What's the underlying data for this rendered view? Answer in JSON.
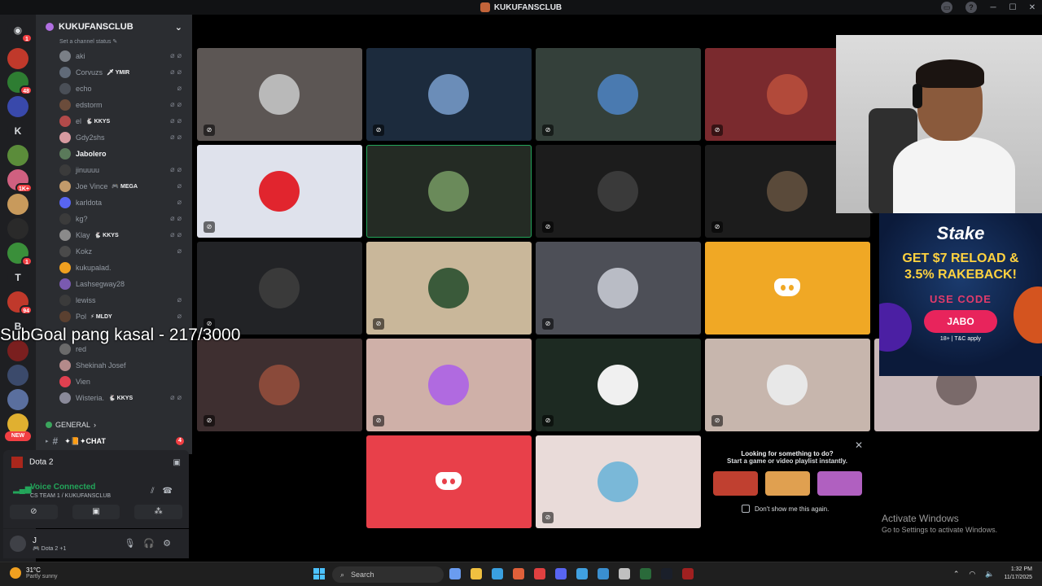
{
  "window": {
    "title": "KUKUFANSCLUB"
  },
  "rail": {
    "servers": [
      {
        "top": 0,
        "color": "#1e1f22",
        "badge": "1"
      },
      {
        "color": "#c0392b",
        "badge": ""
      },
      {
        "color": "#2e7d32",
        "badge": "48"
      },
      {
        "color": "#3949ab",
        "badge": ""
      },
      {
        "letter": "K"
      },
      {
        "color": "#5b8c3a",
        "badge": ""
      },
      {
        "color": "#d06080",
        "badge": "1K+"
      },
      {
        "color": "#c89a5c",
        "badge": ""
      },
      {
        "color": "#2a2a2a",
        "badge": ""
      },
      {
        "color": "#3a8f3a",
        "badge": "1"
      },
      {
        "letter": "T"
      },
      {
        "color": "#c0392b",
        "badge": "94"
      },
      {
        "letter": "B"
      },
      {
        "color": "#7a1f1f",
        "badge": ""
      },
      {
        "color": "#3b4a6b",
        "badge": ""
      },
      {
        "color": "#5a6f9e",
        "badge": ""
      },
      {
        "color": "#e0b030",
        "badge": ""
      }
    ],
    "new_label": "NEW"
  },
  "sidebar": {
    "server_name": "KUKUFANSCLUB",
    "status_hint": "Set a channel status",
    "members": [
      {
        "name": "aki",
        "tag": "",
        "color": "#7a7f86",
        "icons": "⌀⌀",
        "bold": false
      },
      {
        "name": "Corvuzs",
        "tag": "🗡 YMIR",
        "color": "#606a78",
        "icons": "⌀⌀",
        "bold": false
      },
      {
        "name": "echo",
        "tag": "",
        "color": "#4a4f57",
        "icons": "⌀",
        "bold": false
      },
      {
        "name": "edstorm",
        "tag": "",
        "color": "#6b4c3b",
        "icons": "⌀⌀",
        "bold": false
      },
      {
        "name": "el",
        "tag": "🐇 KKYS",
        "color": "#b24a4a",
        "icons": "⌀⌀",
        "bold": false
      },
      {
        "name": "Gdy2shs",
        "tag": "",
        "color": "#d79aa0",
        "icons": "⌀⌀",
        "bold": false
      },
      {
        "name": "Jabolero",
        "tag": "",
        "color": "#5a7a5a",
        "icons": "",
        "bold": true
      },
      {
        "name": "jinuuuu",
        "tag": "",
        "color": "#3b3b3b",
        "icons": "⌀⌀",
        "bold": false
      },
      {
        "name": "Joe Vince",
        "tag": "🎮 MEGA",
        "color": "#c29a6b",
        "icons": "⌀",
        "bold": false
      },
      {
        "name": "karldota",
        "tag": "",
        "color": "#5865f2",
        "icons": "⌀",
        "bold": false
      },
      {
        "name": "kg?",
        "tag": "",
        "color": "#3b3b3b",
        "icons": "⌀⌀",
        "bold": false
      },
      {
        "name": "Klay",
        "tag": "🐇 KKYS",
        "color": "#8a8a8a",
        "icons": "⌀⌀",
        "bold": false
      },
      {
        "name": "Kokz",
        "tag": "",
        "color": "#4a4a4a",
        "icons": "⌀",
        "bold": false
      },
      {
        "name": "kukupalad.",
        "tag": "",
        "color": "#f0a020",
        "icons": "",
        "bold": false
      },
      {
        "name": "Lashsegway28",
        "tag": "",
        "color": "#7a5ab0",
        "icons": "",
        "bold": false
      },
      {
        "name": "lewiss",
        "tag": "",
        "color": "#3b3b3b",
        "icons": "⌀",
        "bold": false
      },
      {
        "name": "Pol",
        "tag": "⚡ MLDY",
        "color": "#5a4030",
        "icons": "⌀",
        "bold": false
      },
      {
        "name": "",
        "tag": "",
        "color": "#2b2d31",
        "icons": "",
        "bold": false
      },
      {
        "name": "red",
        "tag": "",
        "color": "#6a6a6a",
        "icons": "",
        "bold": false
      },
      {
        "name": "Shekinah Josef",
        "tag": "",
        "color": "#b48a8a",
        "icons": "",
        "bold": false
      },
      {
        "name": "Vien",
        "tag": "",
        "color": "#e04050",
        "icons": "",
        "bold": false
      },
      {
        "name": "Wisteria.",
        "tag": "🐇 KKYS",
        "color": "#8a8a9a",
        "icons": "⌀⌀",
        "bold": false
      }
    ],
    "category": "GENERAL",
    "chat_channel": "✦📙✦CHAT",
    "chat_badge": "4"
  },
  "voice": {
    "activity": "Dota 2",
    "status": "Voice Connected",
    "channel": "CS TEAM 1 / KUKUFANSCLUB"
  },
  "user": {
    "name": "J",
    "status": "🎮 Dota 2 +1"
  },
  "overlay": {
    "subgoal": "SubGoal pang kasal - 217/3000"
  },
  "tiles": [
    {
      "bg": "#5c5654",
      "av": "#b9b9b9",
      "mute": true,
      "type": "avatar"
    },
    {
      "bg": "#1c2b3d",
      "av": "#6b8db8",
      "mute": true,
      "type": "avatar"
    },
    {
      "bg": "#34403a",
      "av": "#4a7ab0",
      "mute": true,
      "type": "avatar"
    },
    {
      "bg": "#7a2a2e",
      "av": "#b24a3a",
      "mute": true,
      "type": "avatar"
    },
    {
      "bg": "#dfe2ec",
      "av": "#e1252e",
      "mute": true,
      "type": "avatar"
    },
    {
      "bg": "#242b24",
      "av": "#6a8a5a",
      "mute": false,
      "type": "avatar",
      "speaking": true
    },
    {
      "bg": "#1c1c1c",
      "av": "#3a3a3a",
      "mute": true,
      "type": "avatar"
    },
    {
      "bg": "#1c1c1c",
      "av": "#5a4a3a",
      "mute": true,
      "type": "avatar"
    },
    {
      "bg": "#222326",
      "av": "#3a3a3a",
      "mute": true,
      "type": "avatar"
    },
    {
      "bg": "#c9b79a",
      "av": "#3a5a3a",
      "mute": true,
      "type": "avatar"
    },
    {
      "bg": "#4d4f57",
      "av": "#b9bcc5",
      "mute": true,
      "type": "avatar"
    },
    {
      "bg": "#f0a825",
      "mute": false,
      "type": "discord"
    },
    {
      "bg": "#3e2f30",
      "av": "#8a4a3a",
      "mute": true,
      "type": "avatar"
    },
    {
      "bg": "#cfb0a8",
      "av": "#b06ae0",
      "mute": true,
      "type": "avatar"
    },
    {
      "bg": "#1d2a22",
      "av": "#f0f0f0",
      "mute": true,
      "type": "avatar"
    },
    {
      "bg": "#c7b6ad",
      "av": "#e8e8e8",
      "mute": true,
      "type": "avatar"
    },
    {
      "bg": "#e8404a",
      "mute": false,
      "type": "discord"
    },
    {
      "bg": "#e9dbd9",
      "av": "#7ab8d8",
      "mute": true,
      "type": "avatar"
    },
    {
      "bg": "#c8b8b8",
      "av": "#7a6a6a",
      "mute": false,
      "type": "avatar"
    }
  ],
  "ad": {
    "brand": "Stake",
    "offer_line1": "GET $7 RELOAD &",
    "offer_line2": "3.5% RAKEBACK!",
    "use_code": "USE CODE",
    "code": "JABO",
    "tc": "18+ | T&C apply"
  },
  "suggest": {
    "line1": "Looking for something to do?",
    "line2": "Start a game or video playlist instantly.",
    "checkbox": "Don't show me this again.",
    "thumb_colors": [
      "#c04030",
      "#e0a050",
      "#b060c0"
    ]
  },
  "activate": {
    "title": "Activate Windows",
    "subtitle": "Go to Settings to activate Windows."
  },
  "taskbar": {
    "temp": "31°C",
    "weather": "Partly sunny",
    "search": "Search",
    "time": "1:32 PM",
    "date": "11/17/2025",
    "app_colors": [
      "#6a9cf0",
      "#f0c040",
      "#3aa0e0",
      "#e0603a",
      "#e04040",
      "#5865f2",
      "#40a0e0",
      "#3a8fd0",
      "#c0c0c0",
      "#2a6a3a",
      "#1a1f2a",
      "#a02020"
    ]
  }
}
